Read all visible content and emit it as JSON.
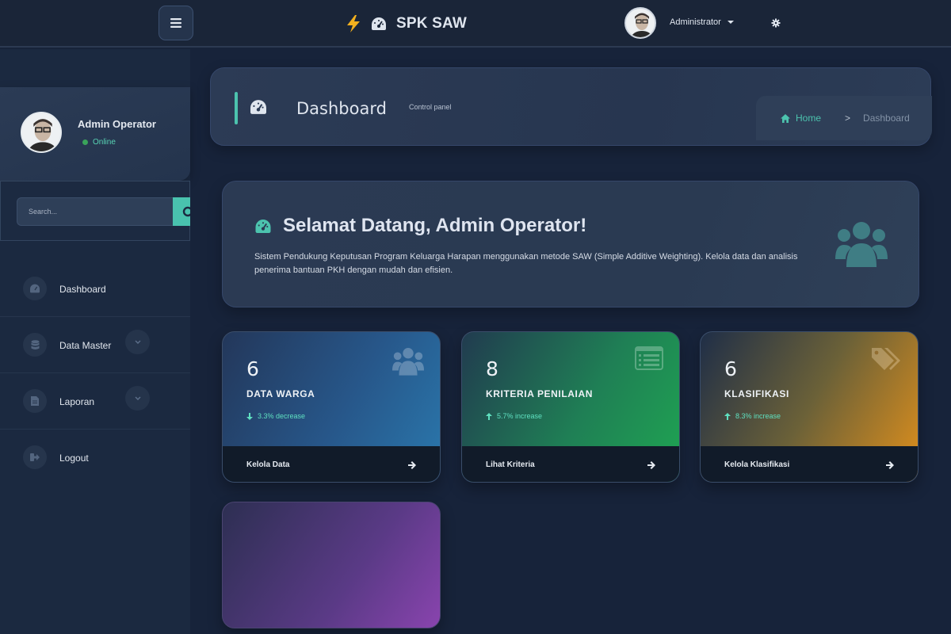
{
  "navbar": {
    "brand_name": "SPK SAW",
    "user_name": "Administrator"
  },
  "sidebar": {
    "user": {
      "name": "Admin Operator",
      "status": "Online"
    },
    "search": {
      "placeholder": "Search..."
    },
    "items": [
      {
        "label": "Dashboard",
        "icon": "dashboard-icon",
        "has_submenu": false
      },
      {
        "label": "Data Master",
        "icon": "database-icon",
        "has_submenu": true
      },
      {
        "label": "Laporan",
        "icon": "file-icon",
        "has_submenu": true
      },
      {
        "label": "Logout",
        "icon": "sign-out-icon",
        "has_submenu": false
      }
    ]
  },
  "header": {
    "title": "Dashboard",
    "subtitle": "Control panel",
    "breadcrumb": {
      "home": "Home",
      "separator": ">",
      "current": "Dashboard"
    }
  },
  "welcome": {
    "title": "Selamat Datang, Admin Operator!",
    "text": "Sistem Pendukung Keputusan Program Keluarga Harapan menggunakan metode SAW (Simple Additive Weighting). Kelola data dan analisis penerima bantuan PKH dengan mudah dan efisien."
  },
  "stats": [
    {
      "value": "6",
      "label": "DATA WARGA",
      "trend": "3.3% decrease",
      "trend_direction": "down",
      "footer": "Kelola Data",
      "icon": "users-icon"
    },
    {
      "value": "8",
      "label": "KRITERIA PENILAIAN",
      "trend": "5.7% increase",
      "trend_direction": "up",
      "footer": "Lihat Kriteria",
      "icon": "list-icon"
    },
    {
      "value": "6",
      "label": "KLASIFIKASI",
      "trend": "8.3% increase",
      "trend_direction": "up",
      "footer": "Kelola Klasifikasi",
      "icon": "tags-icon"
    }
  ],
  "colors": {
    "accent": "#4cc3ae",
    "background": "#17233a",
    "card_blue": "#2a78ad",
    "card_green": "#1fa552",
    "card_orange": "#e0901c",
    "card_purple": "#8944ae"
  }
}
